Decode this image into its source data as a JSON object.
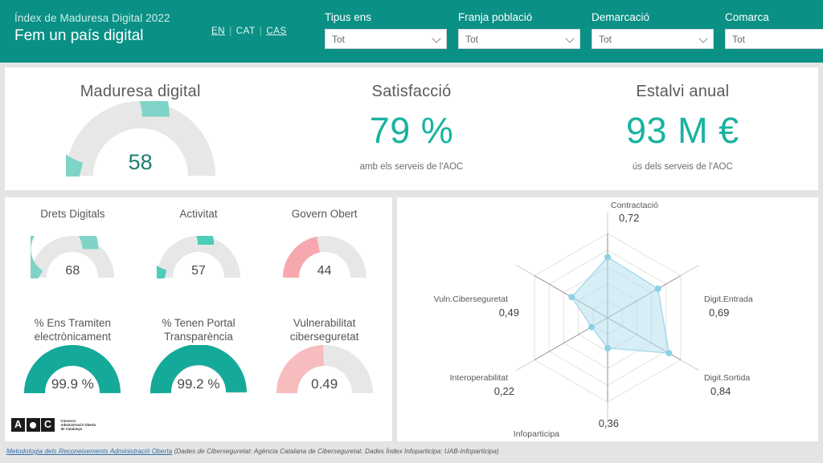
{
  "header": {
    "subtitle": "Índex de Maduresa Digital 2022",
    "title": "Fem un país digital",
    "languages": [
      {
        "code": "EN",
        "active": true
      },
      {
        "code": "CAT",
        "active": false
      },
      {
        "code": "CAS",
        "active": true
      }
    ],
    "separator": "|",
    "background_color": "#0a9085",
    "filters": [
      {
        "label": "Tipus ens",
        "value": "Tot",
        "placeholder": "Tot"
      },
      {
        "label": "Franja població",
        "value": "Tot",
        "placeholder": "Tot"
      },
      {
        "label": "Demarcació",
        "value": "Tot",
        "placeholder": "Tot"
      },
      {
        "label": "Comarca",
        "value": "Tot",
        "placeholder": "Tot"
      }
    ]
  },
  "kpis": {
    "maduresa": {
      "title": "Maduresa digital",
      "value": "58",
      "percent": 58,
      "color": "#7fd4c7",
      "track_color": "#e7e7e7"
    },
    "satisfaccio": {
      "title": "Satisfacció",
      "value": "79 %",
      "subtitle": "amb els serveis de l'AOC",
      "color": "#18b39f"
    },
    "estalvi": {
      "title": "Estalvi anual",
      "value": "93 M €",
      "subtitle": "ús dels serveis de l'AOC",
      "color": "#18b39f"
    }
  },
  "mini_gauges": [
    {
      "title": "Drets Digitals",
      "value": "68",
      "percent": 68,
      "color": "#7fd4c7"
    },
    {
      "title": "Activitat",
      "value": "57",
      "percent": 57,
      "color": "#4ecdb8"
    },
    {
      "title": "Govern Obert",
      "value": "44",
      "percent": 44,
      "color": "#f7a8ae"
    },
    {
      "title": "% Ens Tramiten electrònicament",
      "value": "99.9 %",
      "percent": 99.9,
      "color": "#15a999"
    },
    {
      "title": "% Tenen Portal Transparència",
      "value": "99.2 %",
      "percent": 99.2,
      "color": "#15a999"
    },
    {
      "title": "Vulnerabilitat ciberseguretat",
      "value": "0.49",
      "percent": 49,
      "color": "#f7bcbe"
    }
  ],
  "chart_data": {
    "type": "radar",
    "title": "",
    "categories": [
      "Contractació",
      "Digit.Entrada",
      "Digit.Sortida",
      "Infoparticipa",
      "Interoperabilitat",
      "Vuln.Ciberseguretat"
    ],
    "values": [
      0.72,
      0.69,
      0.84,
      0.36,
      0.22,
      0.49
    ],
    "value_labels": [
      "0,72",
      "0,69",
      "0,84",
      "0,36",
      "0,22",
      "0,49"
    ],
    "rlim": [
      0,
      1
    ],
    "rings": 5,
    "grid": true,
    "legend": false,
    "fill_color": "#b6e0ef",
    "line_color": "#9ed5e8",
    "marker_color": "#8fd0e6"
  },
  "logo": {
    "letters": [
      "A",
      "O",
      "C"
    ],
    "line1": "Consorci",
    "line2": "Administració Oberta",
    "line3": "de Catalunya"
  },
  "footer": {
    "link": "Metodologia dels Reconeixements Administració Oberta",
    "note": "(Dades de Ciberseguretat: Agència Catalana de Ciberseguretat. Dades Índex Infoparticipa: UAB-Infoparticipa)"
  }
}
